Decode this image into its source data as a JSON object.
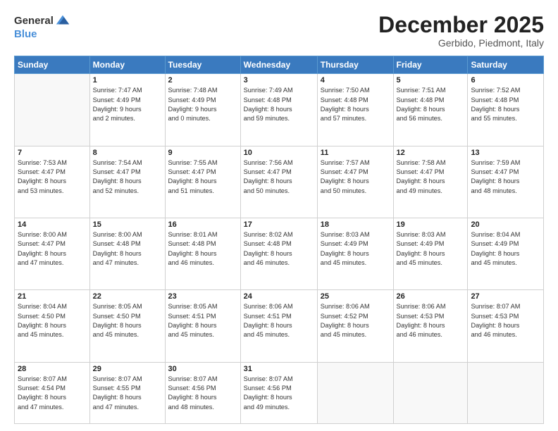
{
  "header": {
    "logo_general": "General",
    "logo_blue": "Blue",
    "month_title": "December 2025",
    "location": "Gerbido, Piedmont, Italy"
  },
  "days_of_week": [
    "Sunday",
    "Monday",
    "Tuesday",
    "Wednesday",
    "Thursday",
    "Friday",
    "Saturday"
  ],
  "weeks": [
    [
      {
        "day": "",
        "info": ""
      },
      {
        "day": "1",
        "info": "Sunrise: 7:47 AM\nSunset: 4:49 PM\nDaylight: 9 hours\nand 2 minutes."
      },
      {
        "day": "2",
        "info": "Sunrise: 7:48 AM\nSunset: 4:49 PM\nDaylight: 9 hours\nand 0 minutes."
      },
      {
        "day": "3",
        "info": "Sunrise: 7:49 AM\nSunset: 4:48 PM\nDaylight: 8 hours\nand 59 minutes."
      },
      {
        "day": "4",
        "info": "Sunrise: 7:50 AM\nSunset: 4:48 PM\nDaylight: 8 hours\nand 57 minutes."
      },
      {
        "day": "5",
        "info": "Sunrise: 7:51 AM\nSunset: 4:48 PM\nDaylight: 8 hours\nand 56 minutes."
      },
      {
        "day": "6",
        "info": "Sunrise: 7:52 AM\nSunset: 4:48 PM\nDaylight: 8 hours\nand 55 minutes."
      }
    ],
    [
      {
        "day": "7",
        "info": "Sunrise: 7:53 AM\nSunset: 4:47 PM\nDaylight: 8 hours\nand 53 minutes."
      },
      {
        "day": "8",
        "info": "Sunrise: 7:54 AM\nSunset: 4:47 PM\nDaylight: 8 hours\nand 52 minutes."
      },
      {
        "day": "9",
        "info": "Sunrise: 7:55 AM\nSunset: 4:47 PM\nDaylight: 8 hours\nand 51 minutes."
      },
      {
        "day": "10",
        "info": "Sunrise: 7:56 AM\nSunset: 4:47 PM\nDaylight: 8 hours\nand 50 minutes."
      },
      {
        "day": "11",
        "info": "Sunrise: 7:57 AM\nSunset: 4:47 PM\nDaylight: 8 hours\nand 50 minutes."
      },
      {
        "day": "12",
        "info": "Sunrise: 7:58 AM\nSunset: 4:47 PM\nDaylight: 8 hours\nand 49 minutes."
      },
      {
        "day": "13",
        "info": "Sunrise: 7:59 AM\nSunset: 4:47 PM\nDaylight: 8 hours\nand 48 minutes."
      }
    ],
    [
      {
        "day": "14",
        "info": "Sunrise: 8:00 AM\nSunset: 4:47 PM\nDaylight: 8 hours\nand 47 minutes."
      },
      {
        "day": "15",
        "info": "Sunrise: 8:00 AM\nSunset: 4:48 PM\nDaylight: 8 hours\nand 47 minutes."
      },
      {
        "day": "16",
        "info": "Sunrise: 8:01 AM\nSunset: 4:48 PM\nDaylight: 8 hours\nand 46 minutes."
      },
      {
        "day": "17",
        "info": "Sunrise: 8:02 AM\nSunset: 4:48 PM\nDaylight: 8 hours\nand 46 minutes."
      },
      {
        "day": "18",
        "info": "Sunrise: 8:03 AM\nSunset: 4:49 PM\nDaylight: 8 hours\nand 45 minutes."
      },
      {
        "day": "19",
        "info": "Sunrise: 8:03 AM\nSunset: 4:49 PM\nDaylight: 8 hours\nand 45 minutes."
      },
      {
        "day": "20",
        "info": "Sunrise: 8:04 AM\nSunset: 4:49 PM\nDaylight: 8 hours\nand 45 minutes."
      }
    ],
    [
      {
        "day": "21",
        "info": "Sunrise: 8:04 AM\nSunset: 4:50 PM\nDaylight: 8 hours\nand 45 minutes."
      },
      {
        "day": "22",
        "info": "Sunrise: 8:05 AM\nSunset: 4:50 PM\nDaylight: 8 hours\nand 45 minutes."
      },
      {
        "day": "23",
        "info": "Sunrise: 8:05 AM\nSunset: 4:51 PM\nDaylight: 8 hours\nand 45 minutes."
      },
      {
        "day": "24",
        "info": "Sunrise: 8:06 AM\nSunset: 4:51 PM\nDaylight: 8 hours\nand 45 minutes."
      },
      {
        "day": "25",
        "info": "Sunrise: 8:06 AM\nSunset: 4:52 PM\nDaylight: 8 hours\nand 45 minutes."
      },
      {
        "day": "26",
        "info": "Sunrise: 8:06 AM\nSunset: 4:53 PM\nDaylight: 8 hours\nand 46 minutes."
      },
      {
        "day": "27",
        "info": "Sunrise: 8:07 AM\nSunset: 4:53 PM\nDaylight: 8 hours\nand 46 minutes."
      }
    ],
    [
      {
        "day": "28",
        "info": "Sunrise: 8:07 AM\nSunset: 4:54 PM\nDaylight: 8 hours\nand 47 minutes."
      },
      {
        "day": "29",
        "info": "Sunrise: 8:07 AM\nSunset: 4:55 PM\nDaylight: 8 hours\nand 47 minutes."
      },
      {
        "day": "30",
        "info": "Sunrise: 8:07 AM\nSunset: 4:56 PM\nDaylight: 8 hours\nand 48 minutes."
      },
      {
        "day": "31",
        "info": "Sunrise: 8:07 AM\nSunset: 4:56 PM\nDaylight: 8 hours\nand 49 minutes."
      },
      {
        "day": "",
        "info": ""
      },
      {
        "day": "",
        "info": ""
      },
      {
        "day": "",
        "info": ""
      }
    ]
  ]
}
